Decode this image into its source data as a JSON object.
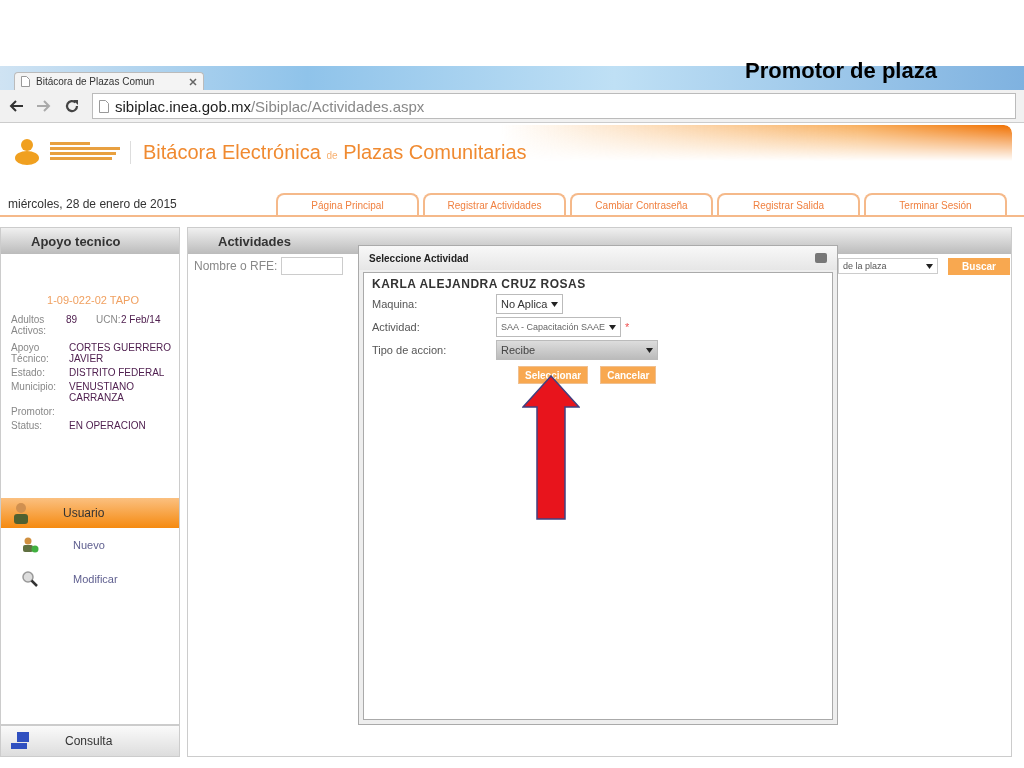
{
  "slide_title": "Promotor de plaza",
  "browser": {
    "tab_title": "Bitácora de Plazas Comun",
    "url_host": "sibiplac.inea.gob.mx",
    "url_path": "/Sibiplac/Actividades.aspx"
  },
  "site": {
    "title_part1": "Bitácora Electrónica",
    "title_join": "de",
    "title_part2": "Plazas Comunitarias",
    "date": "miércoles, 28 de enero de 2015"
  },
  "nav_tabs": [
    "Página Principal",
    "Registrar Actividades",
    "Cambiar Contraseña",
    "Registrar Salida",
    "Terminar Sesión"
  ],
  "left_panel": {
    "header": "Apoyo tecnico",
    "plaza_code": "1-09-022-02 TAPO",
    "adultos_label": "Adultos Activos:",
    "adultos_value": "89",
    "ucn_label": "UCN:",
    "ucn_value": "2 Feb/14",
    "fields": [
      {
        "label": "Apoyo Técnico:",
        "value": "CORTES GUERRERO JAVIER"
      },
      {
        "label": "Estado:",
        "value": "DISTRITO FEDERAL"
      },
      {
        "label": "Municipio:",
        "value": "VENUSTIANO CARRANZA"
      },
      {
        "label": "Promotor:"
      },
      {
        "label": "Status:",
        "value": "EN OPERACION"
      }
    ],
    "menu_header": "Usuario",
    "menu_items": [
      {
        "label": "Nuevo",
        "kind": "user-add"
      },
      {
        "label": "Modificar",
        "kind": "search"
      }
    ],
    "footer": "Consulta"
  },
  "activities": {
    "header": "Actividades",
    "search_label": "Nombre o RFE:",
    "plaza_select": "de la plaza",
    "search_button": "Buscar"
  },
  "dialog": {
    "title": "Seleccione Actividad",
    "person": "KARLA ALEJANDRA CRUZ ROSAS",
    "fields": [
      {
        "label": "Maquina:",
        "value": "No Aplica",
        "disabled": false
      },
      {
        "label": "Actividad:",
        "value": "SAA - Capacitación SAAE",
        "disabled": false,
        "required_mark": "*"
      },
      {
        "label": "Tipo de accion:",
        "value": "Recibe",
        "disabled": true
      }
    ],
    "buttons": [
      "Seleccionar",
      "Cancelar"
    ]
  }
}
